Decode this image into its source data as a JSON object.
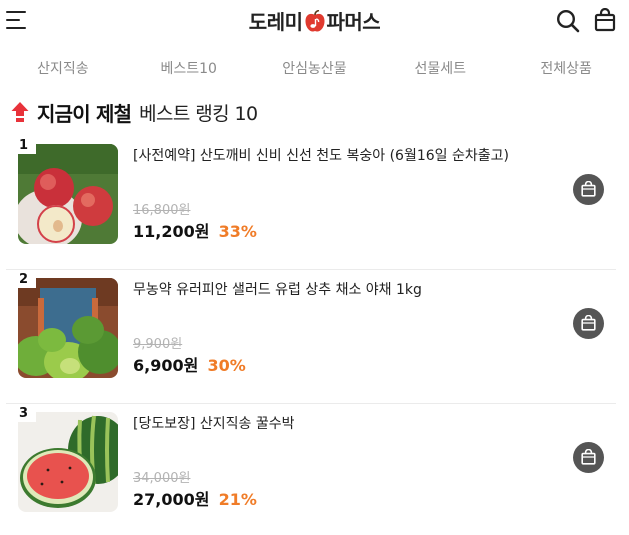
{
  "brand": {
    "name_part1": "도레미",
    "name_part2": "파머스",
    "accent": "#e03a2f"
  },
  "header": {
    "menu_icon": "hamburger-icon",
    "search_icon": "search-icon",
    "bag_icon": "shopping-bag-icon"
  },
  "nav": {
    "items": [
      {
        "label": "산지직송"
      },
      {
        "label": "베스트10"
      },
      {
        "label": "안심농산물"
      },
      {
        "label": "선물세트"
      },
      {
        "label": "전체상품"
      }
    ]
  },
  "ranking": {
    "icon": "red-flame-icon",
    "title_strong": "지금이 제철",
    "title_light": "베스트 랭킹 10"
  },
  "products": [
    {
      "rank": "1",
      "name": "[사전예약] 산도깨비 신비 신선 천도 복숭아 (6월16일 순차출고)",
      "original_price": "16,800원",
      "price": "11,200원",
      "discount": "33%",
      "image": "peaches"
    },
    {
      "rank": "2",
      "name": "무농약 유러피안 샐러드 유럽 상추 채소 야채 1kg",
      "original_price": "9,900원",
      "price": "6,900원",
      "discount": "30%",
      "image": "lettuce"
    },
    {
      "rank": "3",
      "name": "[당도보장] 산지직송 꿀수박",
      "original_price": "34,000원",
      "price": "27,000원",
      "discount": "21%",
      "image": "watermelon"
    }
  ],
  "colors": {
    "discount": "#f07c28",
    "cart_button": "#555555",
    "nav_text": "#8a8a8a"
  }
}
